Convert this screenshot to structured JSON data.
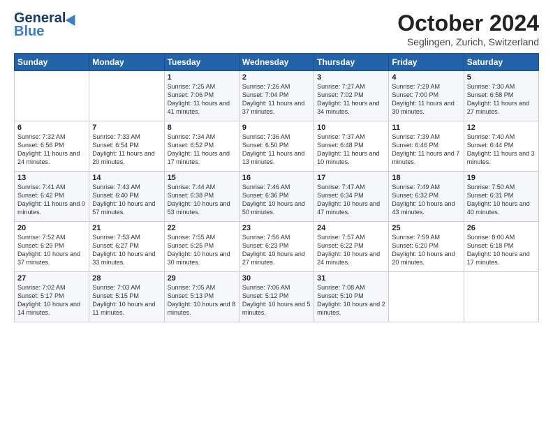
{
  "header": {
    "logo_line1": "General",
    "logo_line2": "Blue",
    "month": "October 2024",
    "location": "Seglingen, Zurich, Switzerland"
  },
  "days_of_week": [
    "Sunday",
    "Monday",
    "Tuesday",
    "Wednesday",
    "Thursday",
    "Friday",
    "Saturday"
  ],
  "weeks": [
    [
      {
        "day": "",
        "sunrise": "",
        "sunset": "",
        "daylight": ""
      },
      {
        "day": "",
        "sunrise": "",
        "sunset": "",
        "daylight": ""
      },
      {
        "day": "1",
        "sunrise": "Sunrise: 7:25 AM",
        "sunset": "Sunset: 7:06 PM",
        "daylight": "Daylight: 11 hours and 41 minutes."
      },
      {
        "day": "2",
        "sunrise": "Sunrise: 7:26 AM",
        "sunset": "Sunset: 7:04 PM",
        "daylight": "Daylight: 11 hours and 37 minutes."
      },
      {
        "day": "3",
        "sunrise": "Sunrise: 7:27 AM",
        "sunset": "Sunset: 7:02 PM",
        "daylight": "Daylight: 11 hours and 34 minutes."
      },
      {
        "day": "4",
        "sunrise": "Sunrise: 7:29 AM",
        "sunset": "Sunset: 7:00 PM",
        "daylight": "Daylight: 11 hours and 30 minutes."
      },
      {
        "day": "5",
        "sunrise": "Sunrise: 7:30 AM",
        "sunset": "Sunset: 6:58 PM",
        "daylight": "Daylight: 11 hours and 27 minutes."
      }
    ],
    [
      {
        "day": "6",
        "sunrise": "Sunrise: 7:32 AM",
        "sunset": "Sunset: 6:56 PM",
        "daylight": "Daylight: 11 hours and 24 minutes."
      },
      {
        "day": "7",
        "sunrise": "Sunrise: 7:33 AM",
        "sunset": "Sunset: 6:54 PM",
        "daylight": "Daylight: 11 hours and 20 minutes."
      },
      {
        "day": "8",
        "sunrise": "Sunrise: 7:34 AM",
        "sunset": "Sunset: 6:52 PM",
        "daylight": "Daylight: 11 hours and 17 minutes."
      },
      {
        "day": "9",
        "sunrise": "Sunrise: 7:36 AM",
        "sunset": "Sunset: 6:50 PM",
        "daylight": "Daylight: 11 hours and 13 minutes."
      },
      {
        "day": "10",
        "sunrise": "Sunrise: 7:37 AM",
        "sunset": "Sunset: 6:48 PM",
        "daylight": "Daylight: 11 hours and 10 minutes."
      },
      {
        "day": "11",
        "sunrise": "Sunrise: 7:39 AM",
        "sunset": "Sunset: 6:46 PM",
        "daylight": "Daylight: 11 hours and 7 minutes."
      },
      {
        "day": "12",
        "sunrise": "Sunrise: 7:40 AM",
        "sunset": "Sunset: 6:44 PM",
        "daylight": "Daylight: 11 hours and 3 minutes."
      }
    ],
    [
      {
        "day": "13",
        "sunrise": "Sunrise: 7:41 AM",
        "sunset": "Sunset: 6:42 PM",
        "daylight": "Daylight: 11 hours and 0 minutes."
      },
      {
        "day": "14",
        "sunrise": "Sunrise: 7:43 AM",
        "sunset": "Sunset: 6:40 PM",
        "daylight": "Daylight: 10 hours and 57 minutes."
      },
      {
        "day": "15",
        "sunrise": "Sunrise: 7:44 AM",
        "sunset": "Sunset: 6:38 PM",
        "daylight": "Daylight: 10 hours and 53 minutes."
      },
      {
        "day": "16",
        "sunrise": "Sunrise: 7:46 AM",
        "sunset": "Sunset: 6:36 PM",
        "daylight": "Daylight: 10 hours and 50 minutes."
      },
      {
        "day": "17",
        "sunrise": "Sunrise: 7:47 AM",
        "sunset": "Sunset: 6:34 PM",
        "daylight": "Daylight: 10 hours and 47 minutes."
      },
      {
        "day": "18",
        "sunrise": "Sunrise: 7:49 AM",
        "sunset": "Sunset: 6:32 PM",
        "daylight": "Daylight: 10 hours and 43 minutes."
      },
      {
        "day": "19",
        "sunrise": "Sunrise: 7:50 AM",
        "sunset": "Sunset: 6:31 PM",
        "daylight": "Daylight: 10 hours and 40 minutes."
      }
    ],
    [
      {
        "day": "20",
        "sunrise": "Sunrise: 7:52 AM",
        "sunset": "Sunset: 6:29 PM",
        "daylight": "Daylight: 10 hours and 37 minutes."
      },
      {
        "day": "21",
        "sunrise": "Sunrise: 7:53 AM",
        "sunset": "Sunset: 6:27 PM",
        "daylight": "Daylight: 10 hours and 33 minutes."
      },
      {
        "day": "22",
        "sunrise": "Sunrise: 7:55 AM",
        "sunset": "Sunset: 6:25 PM",
        "daylight": "Daylight: 10 hours and 30 minutes."
      },
      {
        "day": "23",
        "sunrise": "Sunrise: 7:56 AM",
        "sunset": "Sunset: 6:23 PM",
        "daylight": "Daylight: 10 hours and 27 minutes."
      },
      {
        "day": "24",
        "sunrise": "Sunrise: 7:57 AM",
        "sunset": "Sunset: 6:22 PM",
        "daylight": "Daylight: 10 hours and 24 minutes."
      },
      {
        "day": "25",
        "sunrise": "Sunrise: 7:59 AM",
        "sunset": "Sunset: 6:20 PM",
        "daylight": "Daylight: 10 hours and 20 minutes."
      },
      {
        "day": "26",
        "sunrise": "Sunrise: 8:00 AM",
        "sunset": "Sunset: 6:18 PM",
        "daylight": "Daylight: 10 hours and 17 minutes."
      }
    ],
    [
      {
        "day": "27",
        "sunrise": "Sunrise: 7:02 AM",
        "sunset": "Sunset: 5:17 PM",
        "daylight": "Daylight: 10 hours and 14 minutes."
      },
      {
        "day": "28",
        "sunrise": "Sunrise: 7:03 AM",
        "sunset": "Sunset: 5:15 PM",
        "daylight": "Daylight: 10 hours and 11 minutes."
      },
      {
        "day": "29",
        "sunrise": "Sunrise: 7:05 AM",
        "sunset": "Sunset: 5:13 PM",
        "daylight": "Daylight: 10 hours and 8 minutes."
      },
      {
        "day": "30",
        "sunrise": "Sunrise: 7:06 AM",
        "sunset": "Sunset: 5:12 PM",
        "daylight": "Daylight: 10 hours and 5 minutes."
      },
      {
        "day": "31",
        "sunrise": "Sunrise: 7:08 AM",
        "sunset": "Sunset: 5:10 PM",
        "daylight": "Daylight: 10 hours and 2 minutes."
      },
      {
        "day": "",
        "sunrise": "",
        "sunset": "",
        "daylight": ""
      },
      {
        "day": "",
        "sunrise": "",
        "sunset": "",
        "daylight": ""
      }
    ]
  ]
}
